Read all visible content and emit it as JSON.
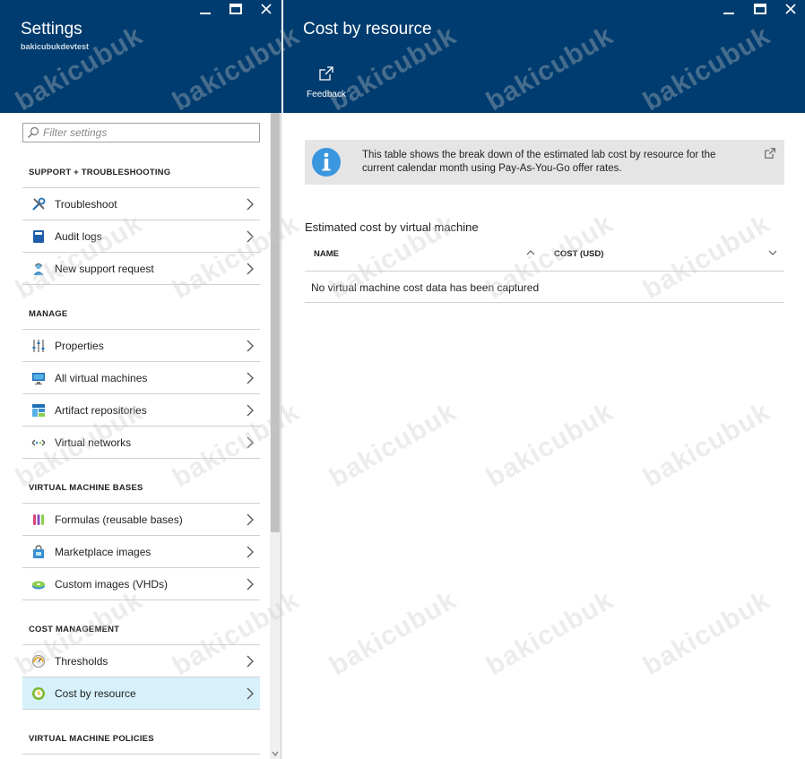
{
  "left_blade": {
    "title": "Settings",
    "subtitle": "bakicubukdevtest",
    "filter_placeholder": "Filter settings",
    "sections": [
      {
        "label": "SUPPORT + TROUBLESHOOTING",
        "items": [
          {
            "label": "Troubleshoot",
            "icon": "tools-icon"
          },
          {
            "label": "Audit logs",
            "icon": "book-icon"
          },
          {
            "label": "New support request",
            "icon": "support-person-icon"
          }
        ]
      },
      {
        "label": "MANAGE",
        "items": [
          {
            "label": "Properties",
            "icon": "sliders-icon"
          },
          {
            "label": "All virtual machines",
            "icon": "monitor-icon"
          },
          {
            "label": "Artifact repositories",
            "icon": "repository-icon"
          },
          {
            "label": "Virtual networks",
            "icon": "network-icon"
          }
        ]
      },
      {
        "label": "VIRTUAL MACHINE BASES",
        "items": [
          {
            "label": "Formulas (reusable bases)",
            "icon": "test-tubes-icon"
          },
          {
            "label": "Marketplace images",
            "icon": "marketplace-bag-icon"
          },
          {
            "label": "Custom images (VHDs)",
            "icon": "disk-icon"
          }
        ]
      },
      {
        "label": "COST MANAGEMENT",
        "items": [
          {
            "label": "Thresholds",
            "icon": "gauge-icon"
          },
          {
            "label": "Cost by resource",
            "icon": "cost-clock-icon",
            "selected": true
          }
        ]
      },
      {
        "label": "VIRTUAL MACHINE POLICIES",
        "items": []
      }
    ]
  },
  "right_blade": {
    "title": "Cost by resource",
    "commands": [
      {
        "label": "Feedback",
        "icon": "external-link-icon"
      }
    ],
    "info_text": "This table shows the break down of the estimated lab cost by resource for the current calendar month using Pay-As-You-Go offer rates.",
    "section_title": "Estimated cost by virtual machine",
    "grid": {
      "columns": [
        "NAME",
        "COST (USD)"
      ],
      "empty_message": "No virtual machine cost data has been captured"
    }
  },
  "watermark": "bakicubuk",
  "colors": {
    "header_bg": "#003c6f",
    "selected_bg": "#d6f1fb",
    "info_bg": "#e5e5e5",
    "info_icon": "#3a96dd"
  }
}
